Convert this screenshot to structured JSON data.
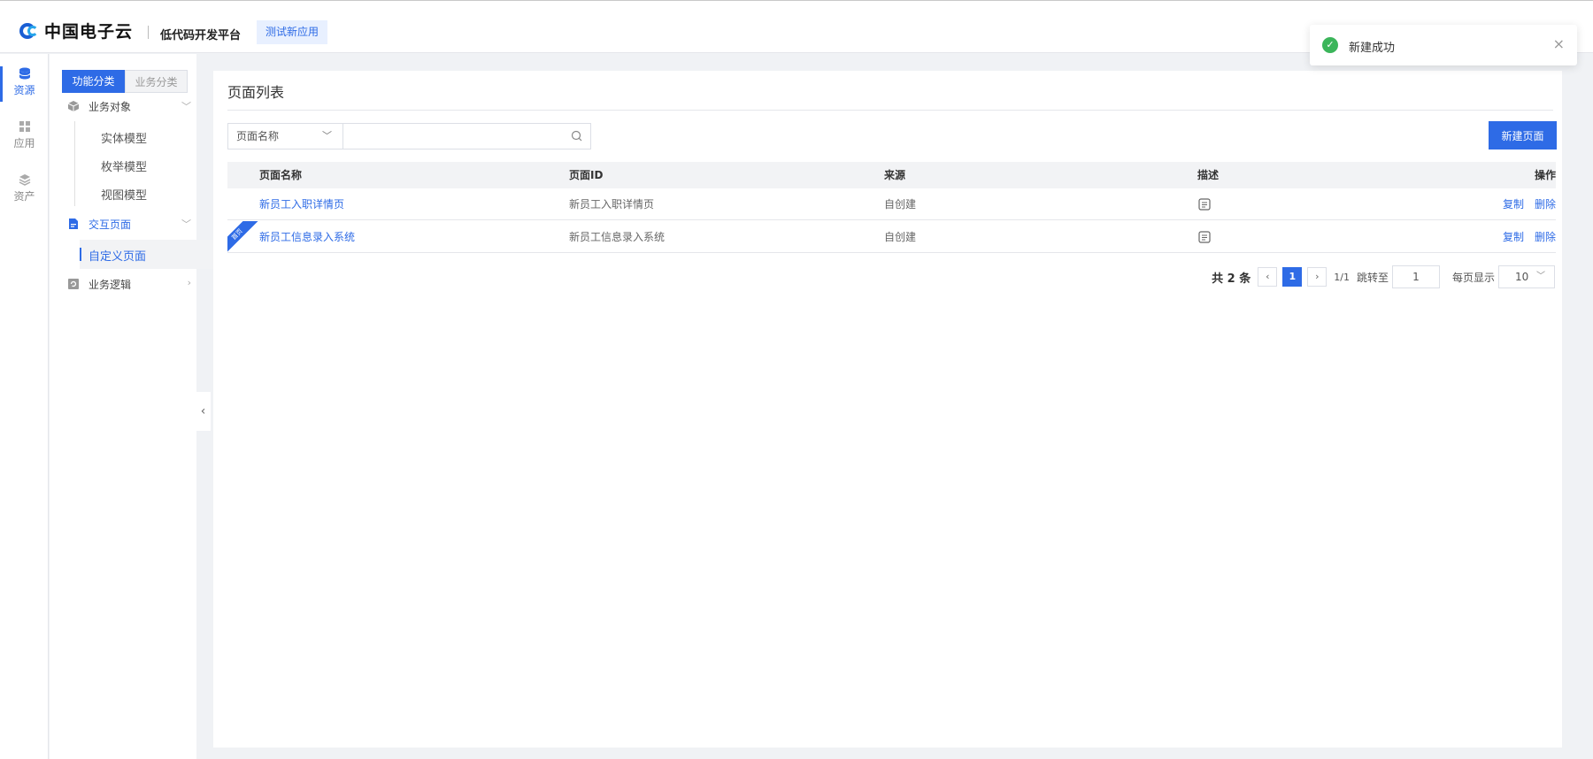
{
  "header": {
    "brand": "中国电子云",
    "platform": "低代码开发平台",
    "app_name": "测试新应用"
  },
  "rail": {
    "items": [
      {
        "label": "资源",
        "icon": "database-icon",
        "active": true
      },
      {
        "label": "应用",
        "icon": "grid-icon",
        "active": false
      },
      {
        "label": "资产",
        "icon": "layers-icon",
        "active": false
      }
    ]
  },
  "sidebar": {
    "tabs": [
      "功能分类",
      "业务分类"
    ],
    "groups": [
      {
        "label": "业务对象",
        "icon": "cube-icon",
        "children": [
          "实体模型",
          "枚举模型",
          "视图模型"
        ]
      },
      {
        "label": "交互页面",
        "icon": "page-icon",
        "children": [
          "自定义页面"
        ]
      },
      {
        "label": "业务逻辑",
        "icon": "logic-icon",
        "children": []
      }
    ]
  },
  "main": {
    "title": "页面列表",
    "filter": {
      "field": "页面名称",
      "value": ""
    },
    "new_button": "新建页面",
    "columns": [
      "页面名称",
      "页面ID",
      "来源",
      "描述",
      "操作"
    ],
    "rows": [
      {
        "name": "新员工入职详情页",
        "id": "新员工入职详情页",
        "source": "自创建",
        "badge": "",
        "actions": [
          "复制",
          "删除"
        ]
      },
      {
        "name": "新员工信息录入系统",
        "id": "新员工信息录入系统",
        "source": "自创建",
        "badge": "首页",
        "actions": [
          "复制",
          "删除"
        ]
      }
    ],
    "pagination": {
      "total": "共 2 条",
      "current": "1",
      "of": "1/1",
      "jump_label": "跳转至",
      "jump_value": "1",
      "per_page_label": "每页显示",
      "per_page": "10"
    }
  },
  "toast": {
    "message": "新建成功",
    "type": "success"
  },
  "colors": {
    "primary": "#2e6be6",
    "success": "#3bb55a",
    "bg": "#f0f2f5"
  }
}
